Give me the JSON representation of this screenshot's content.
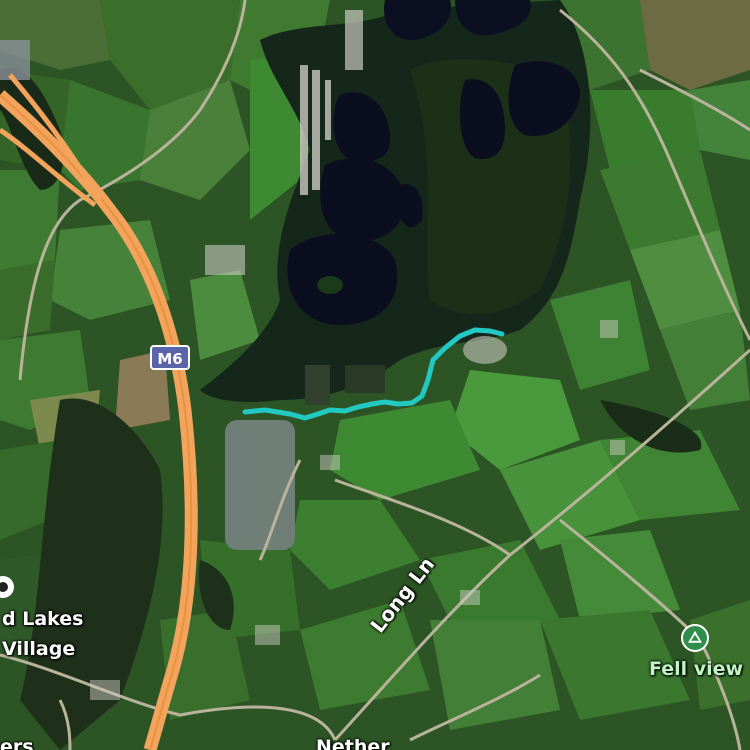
{
  "map": {
    "type": "satellite",
    "colors": {
      "motorway": "#f2a35c",
      "route": "#22c9c2",
      "water": "#0a0f1f",
      "field_light": "#3f7f32",
      "forest": "#1a2f16",
      "poi_green": "#2f8f4a",
      "shield": "#5a64a8"
    }
  },
  "labels": {
    "road_shield": "M6",
    "long_ln": "Long Ln",
    "poi_name": "Fell view",
    "lakes_line1": "d Lakes",
    "lakes_line2": "Village",
    "bottom_text": "Nether",
    "bottom_left_text": "ers"
  },
  "icons": {
    "poi": "mountain-viewpoint-icon",
    "left_poi": "place-icon"
  }
}
